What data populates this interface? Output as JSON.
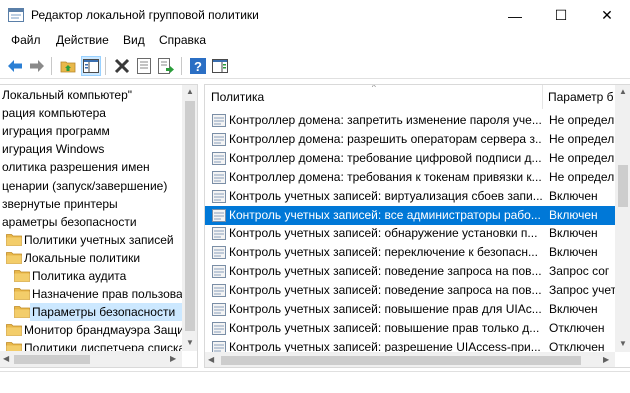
{
  "window": {
    "title": "Редактор локальной групповой политики",
    "minimize_glyph": "—",
    "maximize_glyph": "☐",
    "close_glyph": "✕"
  },
  "menu": {
    "file": "Файл",
    "action": "Действие",
    "view": "Вид",
    "help": "Справка"
  },
  "toolbar": {
    "icons": [
      "back-arrow-icon",
      "forward-arrow-icon",
      "up-folder-icon",
      "show-hide-tree-icon",
      "delete-icon",
      "properties-icon",
      "export-list-icon",
      "help-icon",
      "show-hide-action-pane-icon"
    ]
  },
  "tree": {
    "items": [
      {
        "label": "Локальный компьютер\"",
        "folder": false
      },
      {
        "label": "рация компьютера",
        "folder": false
      },
      {
        "label": "игурация программ",
        "folder": false
      },
      {
        "label": "игурация Windows",
        "folder": false
      },
      {
        "label": "олитика разрешения имен",
        "folder": false
      },
      {
        "label": "ценарии (запуск/завершение)",
        "folder": false
      },
      {
        "label": "звернутые принтеры",
        "folder": false
      },
      {
        "label": "араметры безопасности",
        "folder": false
      },
      {
        "label": "Политики учетных записей",
        "folder": true
      },
      {
        "label": "Локальные политики",
        "folder": true
      },
      {
        "label": "Политика аудита",
        "folder": true
      },
      {
        "label": "Назначение прав пользова",
        "folder": true
      },
      {
        "label": "Параметры безопасности",
        "folder": true,
        "selected": true
      },
      {
        "label": "Монитор брандмауэра Защит",
        "folder": true
      },
      {
        "label": "Политики диспетчера списка с",
        "folder": true
      }
    ]
  },
  "list": {
    "col_policy": "Политика",
    "col_setting": "Параметр б",
    "rows": [
      {
        "name": "Контроллер домена: запретить изменение пароля уче...",
        "value": "Не определ"
      },
      {
        "name": "Контроллер домена: разрешить операторам сервера з...",
        "value": "Не определ"
      },
      {
        "name": "Контроллер домена: требование цифровой подписи д...",
        "value": "Не определ"
      },
      {
        "name": "Контроллер домена: требования к токенам привязки к...",
        "value": "Не определ"
      },
      {
        "name": "Контроль учетных записей: виртуализация сбоев запи...",
        "value": "Включен"
      },
      {
        "name": "Контроль учетных записей: все администраторы рабо...",
        "value": "Включен",
        "selected": true
      },
      {
        "name": "Контроль учетных записей: обнаружение установки п...",
        "value": "Включен"
      },
      {
        "name": "Контроль учетных записей: переключение к безопасн...",
        "value": "Включен"
      },
      {
        "name": "Контроль учетных записей: поведение запроса на пов...",
        "value": "Запрос сог"
      },
      {
        "name": "Контроль учетных записей: поведение запроса на пов...",
        "value": "Запрос учет"
      },
      {
        "name": "Контроль учетных записей: повышение прав для UIAc...",
        "value": "Включен"
      },
      {
        "name": "Контроль учетных записей: повышение прав только д...",
        "value": "Отключен"
      },
      {
        "name": "Контроль учетных записей: разрешение UIAccess-при...",
        "value": "Отключен"
      }
    ]
  },
  "colors": {
    "selection": "#0078d7",
    "tree_selection": "#cce8ff",
    "folder": "#e8b84a"
  }
}
